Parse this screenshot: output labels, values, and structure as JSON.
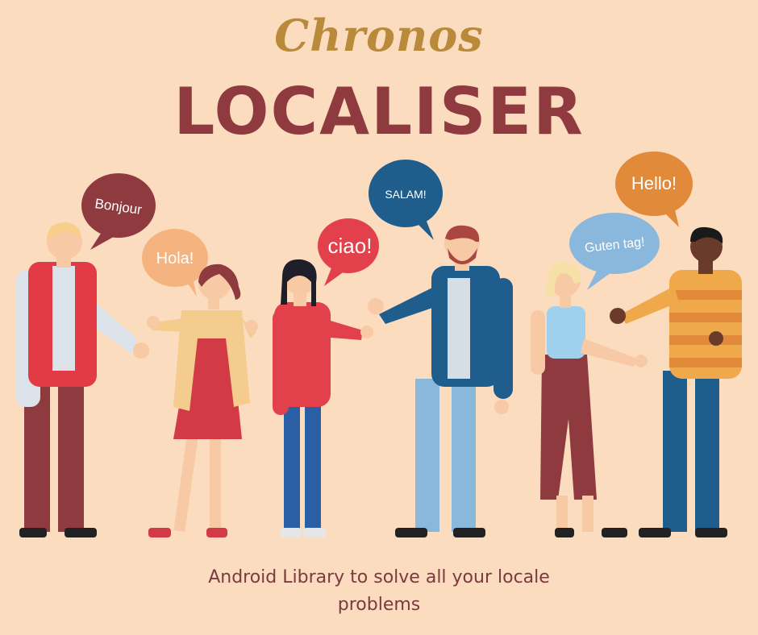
{
  "header": {
    "brand": "Chronos",
    "title": "LOCALISER"
  },
  "tagline": {
    "line1": "Android Library to solve all your locale",
    "line2": "problems"
  },
  "bubbles": {
    "bonjour": "Bonjour",
    "hola": "Hola!",
    "ciao": "ciao!",
    "salam": "SALAM!",
    "guten_tag": "Guten tag!",
    "hello": "Hello!"
  },
  "colors": {
    "background": "#fbdcbf",
    "title": "#8e3a3f",
    "brand": "#b98a3a",
    "bubble_maroon": "#8e3a3f",
    "bubble_peach": "#f4b37f",
    "bubble_red": "#e2404a",
    "bubble_blue": "#1f5d8c",
    "bubble_lightblue": "#8ab8dc",
    "bubble_orange": "#e08a3a"
  }
}
